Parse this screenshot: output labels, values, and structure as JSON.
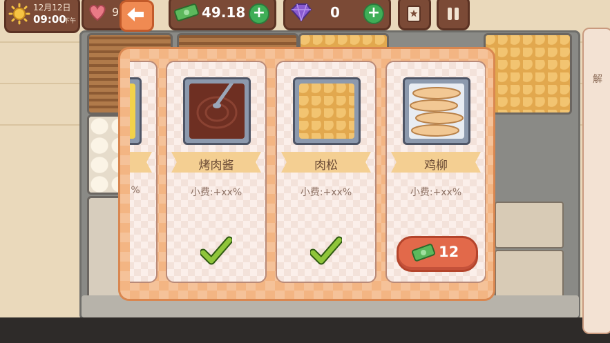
{
  "hud": {
    "date": "12月12日",
    "time": "09:00",
    "time_period": "下午",
    "hearts": "9",
    "money": "49.18",
    "gems": "0",
    "colors": {
      "hud_bg": "#7b4a36",
      "plus_green": "#3fae57",
      "back_orange": "#f08a52"
    }
  },
  "side_panel": {
    "label": "解"
  },
  "modal": {
    "cards": [
      {
        "name": "",
        "tip": "%",
        "status": "unlocked",
        "visible": "partial"
      },
      {
        "name": "烤肉酱",
        "tip": "小费:+xx%",
        "status": "unlocked",
        "icon": "bbq-sauce-icon"
      },
      {
        "name": "肉松",
        "tip": "小费:+xx%",
        "status": "unlocked",
        "icon": "meat-floss-icon"
      },
      {
        "name": "鸡柳",
        "tip": "小费:+xx%",
        "status": "locked",
        "price": "12",
        "icon": "chicken-strips-icon"
      }
    ]
  }
}
